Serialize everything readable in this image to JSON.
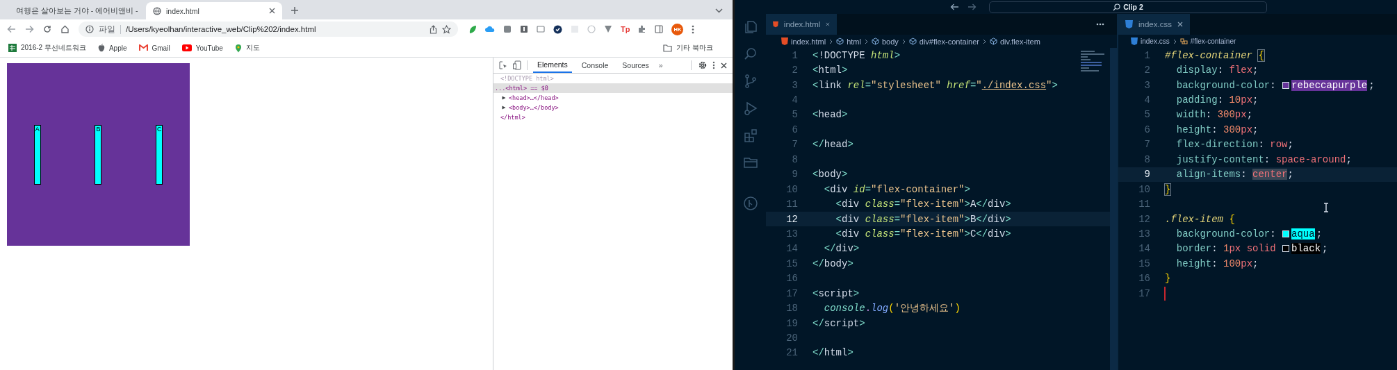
{
  "browser": {
    "tabs": [
      {
        "label": "여행은 살아보는 거야 - 에어비앤비 -",
        "kind": "site",
        "selected": false
      },
      {
        "label": "index.html",
        "kind": "local",
        "selected": true
      }
    ],
    "address": {
      "scheme": "파일",
      "url": "/Users/kyeolhan/interactive_web/Clip%202/index.html"
    },
    "extension_badge": "Tp",
    "profile": "HK",
    "bookmarks": [
      {
        "label": "2016-2 무선네트워크",
        "kind": "sheet"
      },
      {
        "label": "Apple",
        "kind": "apple"
      },
      {
        "label": "Gmail",
        "kind": "mail"
      },
      {
        "label": "YouTube",
        "kind": "video"
      },
      {
        "label": "지도",
        "kind": "pin"
      }
    ],
    "other_bookmarks": "기타 북마크",
    "page": {
      "items": [
        "A",
        "B",
        "C"
      ]
    },
    "devtools": {
      "tabs": [
        {
          "label": "Elements",
          "selected": true
        },
        {
          "label": "Console",
          "selected": false
        },
        {
          "label": "Sources",
          "selected": false
        }
      ],
      "more": "»",
      "dom": [
        {
          "text": "<!DOCTYPE html>",
          "selected": false
        },
        {
          "text": "...<html> == $0",
          "selected": true,
          "closing": "</html>",
          "children": [
            {
              "text": "<head>…</head>",
              "expanded": false,
              "selected": false
            },
            {
              "text": "<body>…</body>",
              "expanded": false,
              "selected": false
            }
          ]
        }
      ]
    }
  },
  "vscode": {
    "search": "Clip 2",
    "editors": [
      {
        "tab": {
          "label": "index.html",
          "kind": "html"
        },
        "breadcrumbs": [
          {
            "label": "index.html",
            "kind": "html"
          },
          {
            "label": "html",
            "kind": "element"
          },
          {
            "label": "body",
            "kind": "element"
          },
          {
            "label": "div#flex-container",
            "kind": "element"
          },
          {
            "label": "div.flex-item",
            "kind": "element"
          }
        ],
        "lines": [
          {
            "number": "1",
            "active": false,
            "tokens": [
              {
                "t": "<",
                "kind": "bracket"
              },
              {
                "t": "!DOCTYPE ",
                "kind": "tag"
              },
              {
                "t": "html",
                "kind": "attr"
              },
              {
                "t": ">",
                "kind": "bracket"
              }
            ]
          },
          {
            "number": "2",
            "active": false,
            "tokens": [
              {
                "t": "<",
                "kind": "bracket"
              },
              {
                "t": "html",
                "kind": "tag"
              },
              {
                "t": ">",
                "kind": "bracket"
              }
            ]
          },
          {
            "number": "3",
            "active": false,
            "tokens": [
              {
                "t": "<",
                "kind": "bracket"
              },
              {
                "t": "link ",
                "kind": "tag"
              },
              {
                "t": "rel",
                "kind": "attr"
              },
              {
                "t": "=",
                "kind": "bracket"
              },
              {
                "t": "\"stylesheet\" ",
                "kind": "str"
              },
              {
                "t": "href",
                "kind": "attr"
              },
              {
                "t": "=",
                "kind": "bracket"
              },
              {
                "t": "\"",
                "kind": "str"
              },
              {
                "t": "./index.css",
                "kind": "link"
              },
              {
                "t": "\"",
                "kind": "str"
              },
              {
                "t": ">",
                "kind": "bracket"
              }
            ]
          },
          {
            "number": "4",
            "active": false
          },
          {
            "number": "5",
            "active": false,
            "tokens": [
              {
                "t": "<",
                "kind": "bracket"
              },
              {
                "t": "head",
                "kind": "tag"
              },
              {
                "t": ">",
                "kind": "bracket"
              }
            ]
          },
          {
            "number": "6",
            "active": false
          },
          {
            "number": "7",
            "active": false,
            "tokens": [
              {
                "t": "</",
                "kind": "bracket"
              },
              {
                "t": "head",
                "kind": "tag"
              },
              {
                "t": ">",
                "kind": "bracket"
              }
            ]
          },
          {
            "number": "8",
            "active": false
          },
          {
            "number": "9",
            "active": false,
            "tokens": [
              {
                "t": "<",
                "kind": "bracket"
              },
              {
                "t": "body",
                "kind": "tag"
              },
              {
                "t": ">",
                "kind": "bracket"
              }
            ]
          },
          {
            "number": "10",
            "active": false,
            "tokens": [
              {
                "t": "  <",
                "kind": "bracket"
              },
              {
                "t": "div ",
                "kind": "tag"
              },
              {
                "t": "id",
                "kind": "attr"
              },
              {
                "t": "=",
                "kind": "bracket"
              },
              {
                "t": "\"flex-container\"",
                "kind": "str"
              },
              {
                "t": ">",
                "kind": "bracket"
              }
            ]
          },
          {
            "number": "11",
            "active": false,
            "tokens": [
              {
                "t": "    <",
                "kind": "bracket"
              },
              {
                "t": "div ",
                "kind": "tag"
              },
              {
                "t": "class",
                "kind": "attr"
              },
              {
                "t": "=",
                "kind": "bracket"
              },
              {
                "t": "\"flex-item\"",
                "kind": "str"
              },
              {
                "t": ">",
                "kind": "bracket"
              },
              {
                "t": "A",
                "kind": "text"
              },
              {
                "t": "</",
                "kind": "bracket"
              },
              {
                "t": "div",
                "kind": "tag"
              },
              {
                "t": ">",
                "kind": "bracket"
              }
            ]
          },
          {
            "number": "12",
            "active": true,
            "tokens": [
              {
                "t": "    <",
                "kind": "bracket"
              },
              {
                "t": "div ",
                "kind": "tag"
              },
              {
                "t": "class",
                "kind": "attr"
              },
              {
                "t": "=",
                "kind": "bracket"
              },
              {
                "t": "\"flex-item\"",
                "kind": "str"
              },
              {
                "t": ">",
                "kind": "bracket"
              },
              {
                "t": "B",
                "kind": "text"
              },
              {
                "t": "</",
                "kind": "bracket"
              },
              {
                "t": "div",
                "kind": "tag"
              },
              {
                "t": ">",
                "kind": "bracket"
              }
            ]
          },
          {
            "number": "13",
            "active": false,
            "tokens": [
              {
                "t": "    <",
                "kind": "bracket"
              },
              {
                "t": "div ",
                "kind": "tag"
              },
              {
                "t": "class",
                "kind": "attr"
              },
              {
                "t": "=",
                "kind": "bracket"
              },
              {
                "t": "\"flex-item\"",
                "kind": "str"
              },
              {
                "t": ">",
                "kind": "bracket"
              },
              {
                "t": "C",
                "kind": "text"
              },
              {
                "t": "</",
                "kind": "bracket"
              },
              {
                "t": "div",
                "kind": "tag"
              },
              {
                "t": ">",
                "kind": "bracket"
              }
            ]
          },
          {
            "number": "14",
            "active": false,
            "tokens": [
              {
                "t": "  </",
                "kind": "bracket"
              },
              {
                "t": "div",
                "kind": "tag"
              },
              {
                "t": ">",
                "kind": "bracket"
              }
            ]
          },
          {
            "number": "15",
            "active": false,
            "tokens": [
              {
                "t": "</",
                "kind": "bracket"
              },
              {
                "t": "body",
                "kind": "tag"
              },
              {
                "t": ">",
                "kind": "bracket"
              }
            ]
          },
          {
            "number": "16",
            "active": false
          },
          {
            "number": "17",
            "active": false,
            "tokens": [
              {
                "t": "<",
                "kind": "bracket"
              },
              {
                "t": "script",
                "kind": "tag"
              },
              {
                "t": ">",
                "kind": "bracket"
              }
            ]
          },
          {
            "number": "18",
            "active": false,
            "tokens": [
              {
                "t": "  console",
                "kind": "obj"
              },
              {
                "t": ".",
                "kind": "dot"
              },
              {
                "t": "log",
                "kind": "fn"
              },
              {
                "t": "(",
                "kind": "paren"
              },
              {
                "t": "'안녕하세요'",
                "kind": "str"
              },
              {
                "t": ")",
                "kind": "paren"
              }
            ]
          },
          {
            "number": "19",
            "active": false,
            "tokens": [
              {
                "t": "</",
                "kind": "bracket"
              },
              {
                "t": "script",
                "kind": "tag"
              },
              {
                "t": ">",
                "kind": "bracket"
              }
            ]
          },
          {
            "number": "20",
            "active": false
          },
          {
            "number": "21",
            "active": false,
            "tokens": [
              {
                "t": "</",
                "kind": "bracket"
              },
              {
                "t": "html",
                "kind": "tag"
              },
              {
                "t": ">",
                "kind": "bracket"
              }
            ]
          }
        ]
      },
      {
        "tab": {
          "label": "index.css",
          "kind": "css"
        },
        "breadcrumbs": [
          {
            "label": "index.css",
            "kind": "css"
          },
          {
            "label": "#flex-container",
            "kind": "selector"
          }
        ],
        "lines": [
          {
            "number": "1",
            "active": false,
            "cursor": false,
            "tokens": [
              {
                "t": "#flex-container ",
                "kind": "selector"
              },
              {
                "t": "{",
                "kind": "brace-match"
              }
            ]
          },
          {
            "number": "2",
            "active": false,
            "cursor": false,
            "tokens": [
              {
                "t": "  display",
                "kind": "prop"
              },
              {
                "t": ": ",
                "kind": "punct"
              },
              {
                "t": "flex",
                "kind": "value"
              },
              {
                "t": ";",
                "kind": "punct"
              }
            ]
          },
          {
            "number": "3",
            "active": false,
            "cursor": false,
            "tokens": [
              {
                "t": "  background-color",
                "kind": "prop"
              },
              {
                "t": ": ",
                "kind": "punct"
              },
              {
                "kind": "swatch",
                "color": "#663399"
              },
              {
                "t": "rebeccapurple",
                "kind": "color-name",
                "color": "#663399"
              },
              {
                "t": ";",
                "kind": "punct"
              }
            ]
          },
          {
            "number": "4",
            "active": false,
            "cursor": false,
            "tokens": [
              {
                "t": "  padding",
                "kind": "prop"
              },
              {
                "t": ": ",
                "kind": "punct"
              },
              {
                "t": "10",
                "kind": "num"
              },
              {
                "t": "px",
                "kind": "value"
              },
              {
                "t": ";",
                "kind": "punct"
              }
            ]
          },
          {
            "number": "5",
            "active": false,
            "cursor": false,
            "tokens": [
              {
                "t": "  width",
                "kind": "prop"
              },
              {
                "t": ": ",
                "kind": "punct"
              },
              {
                "t": "300",
                "kind": "num"
              },
              {
                "t": "px",
                "kind": "value"
              },
              {
                "t": ";",
                "kind": "punct"
              }
            ]
          },
          {
            "number": "6",
            "active": false,
            "cursor": false,
            "tokens": [
              {
                "t": "  height",
                "kind": "prop"
              },
              {
                "t": ": ",
                "kind": "punct"
              },
              {
                "t": "300",
                "kind": "num"
              },
              {
                "t": "px",
                "kind": "value"
              },
              {
                "t": ";",
                "kind": "punct"
              }
            ]
          },
          {
            "number": "7",
            "active": false,
            "cursor": false,
            "tokens": [
              {
                "t": "  flex-direction",
                "kind": "prop"
              },
              {
                "t": ": ",
                "kind": "punct"
              },
              {
                "t": "row",
                "kind": "value"
              },
              {
                "t": ";",
                "kind": "punct"
              }
            ]
          },
          {
            "number": "8",
            "active": false,
            "cursor": false,
            "tokens": [
              {
                "t": "  justify-content",
                "kind": "prop"
              },
              {
                "t": ": ",
                "kind": "punct"
              },
              {
                "t": "space-around",
                "kind": "value"
              },
              {
                "t": ";",
                "kind": "punct"
              }
            ]
          },
          {
            "number": "9",
            "active": true,
            "cursor": false,
            "tokens": [
              {
                "t": "  align-items",
                "kind": "prop"
              },
              {
                "t": ": ",
                "kind": "punct"
              },
              {
                "t": "center",
                "kind": "match"
              },
              {
                "t": ";",
                "kind": "punct"
              }
            ]
          },
          {
            "number": "10",
            "active": false,
            "cursor": false,
            "tokens": [
              {
                "t": "}",
                "kind": "brace-match"
              }
            ]
          },
          {
            "number": "11",
            "active": false,
            "cursor": false
          },
          {
            "number": "12",
            "active": false,
            "cursor": false,
            "tokens": [
              {
                "t": ".flex-item ",
                "kind": "selector"
              },
              {
                "t": "{",
                "kind": "brace"
              }
            ]
          },
          {
            "number": "13",
            "active": false,
            "cursor": false,
            "tokens": [
              {
                "t": "  background-color",
                "kind": "prop"
              },
              {
                "t": ": ",
                "kind": "punct"
              },
              {
                "kind": "swatch",
                "color": "#00ffff"
              },
              {
                "t": "aqua",
                "kind": "color-name",
                "color": "#00ffff"
              },
              {
                "t": ";",
                "kind": "punct"
              }
            ]
          },
          {
            "number": "14",
            "active": false,
            "cursor": false,
            "tokens": [
              {
                "t": "  border",
                "kind": "prop"
              },
              {
                "t": ": ",
                "kind": "punct"
              },
              {
                "t": "1",
                "kind": "num"
              },
              {
                "t": "px solid ",
                "kind": "value"
              },
              {
                "kind": "swatch",
                "color": "#000000"
              },
              {
                "t": "black",
                "kind": "color-name",
                "color": "#000000"
              },
              {
                "t": ";",
                "kind": "punct"
              }
            ]
          },
          {
            "number": "15",
            "active": false,
            "cursor": false,
            "tokens": [
              {
                "t": "  height",
                "kind": "prop"
              },
              {
                "t": ": ",
                "kind": "punct"
              },
              {
                "t": "100",
                "kind": "num"
              },
              {
                "t": "px",
                "kind": "value"
              },
              {
                "t": ";",
                "kind": "punct"
              }
            ]
          },
          {
            "number": "16",
            "active": false,
            "cursor": false,
            "tokens": [
              {
                "t": "}",
                "kind": "brace"
              }
            ]
          },
          {
            "number": "17",
            "active": false,
            "cursor": true
          }
        ]
      }
    ]
  }
}
